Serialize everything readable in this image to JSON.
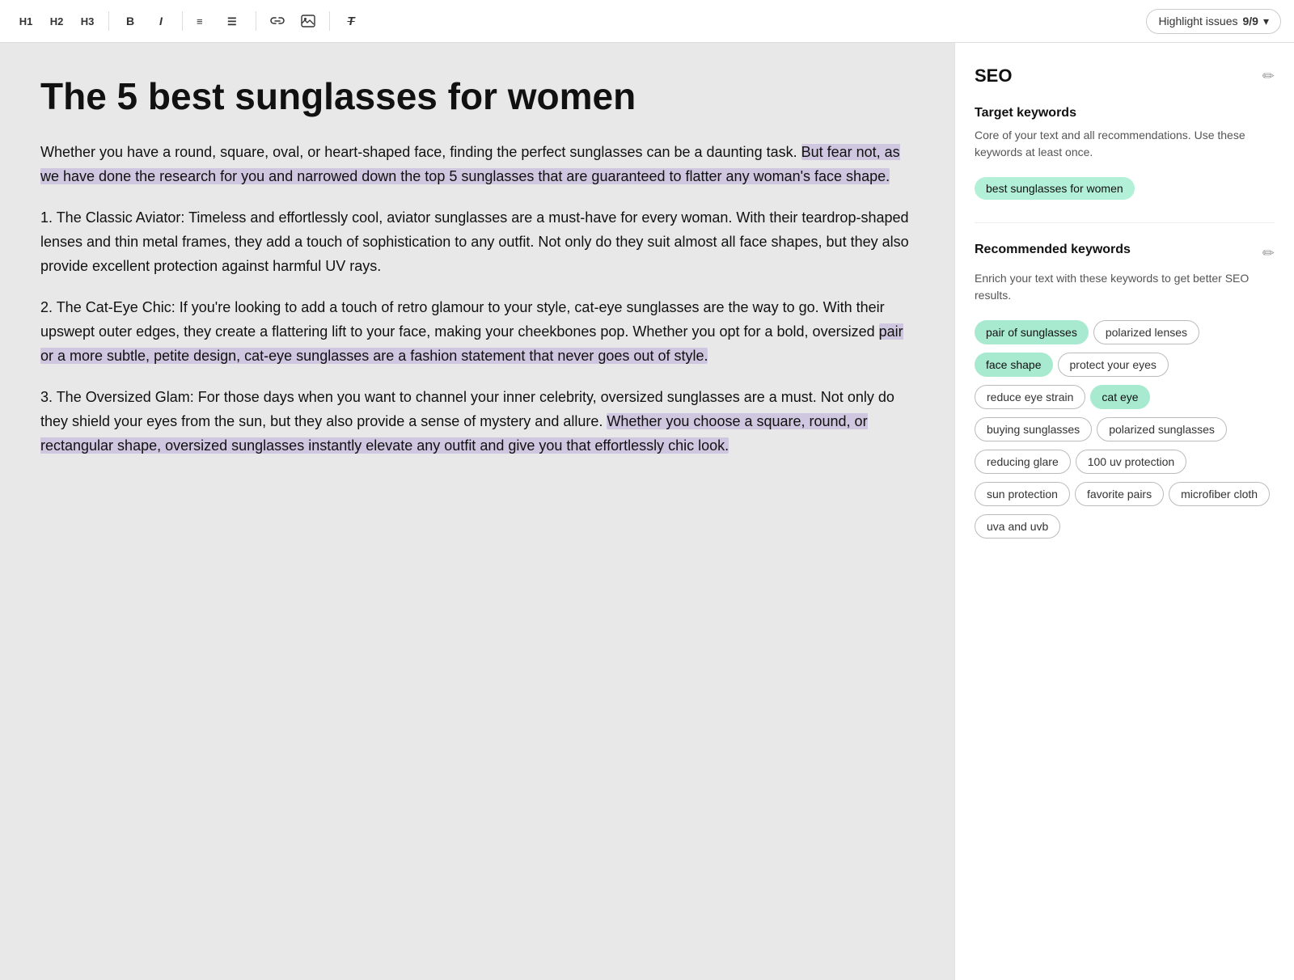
{
  "toolbar": {
    "h1_label": "H1",
    "h2_label": "H2",
    "h3_label": "H3",
    "bold_label": "B",
    "italic_label": "I",
    "highlight_issues_label": "Highlight issues",
    "highlight_count": "9/9",
    "chevron": "▾"
  },
  "editor": {
    "title": "The 5 best sunglasses for women",
    "paragraphs": [
      {
        "id": "p1",
        "text_plain": "Whether you have a round, square, oval, or heart-shaped face, finding the perfect sunglasses can be a daunting task.",
        "text_highlighted": "But fear not, as we have done the research for you and narrowed down the top 5 sunglasses that are guaranteed to flatter any woman's face shape.",
        "highlight": true
      },
      {
        "id": "p2",
        "text_plain": "1. The Classic Aviator: Timeless and effortlessly cool, aviator sunglasses are a must-have for every woman. With their teardrop-shaped lenses and thin metal frames, they add a touch of sophistication to any outfit. Not only do they suit almost all face shapes, but they also provide excellent protection against harmful UV rays.",
        "highlight": false
      },
      {
        "id": "p3",
        "text_before": "2. The Cat-Eye Chic: If you're looking to add a touch of retro glamour to your style, cat-eye sunglasses are the way to go. With their upswept outer edges, they create a flattering lift to your face, making your cheekbones pop. Whether you opt for a bold, oversized",
        "text_highlighted": "pair or a more subtle, petite design, cat-eye sunglasses are a fashion statement that never goes out of style.",
        "highlight": true
      },
      {
        "id": "p4",
        "text_before": "3. The Oversized Glam: For those days when you want to channel your inner celebrity, oversized sunglasses are a must. Not only do they shield your eyes from the sun, but they also provide a sense of mystery and allure.",
        "text_highlighted": "Whether you choose a square, round, or rectangular shape, oversized sunglasses instantly elevate any outfit and give you that effortlessly chic look.",
        "highlight": true
      }
    ]
  },
  "seo": {
    "title": "SEO",
    "target_keywords_title": "Target keywords",
    "target_keywords_desc": "Core of your text and all recommendations. Use these keywords at least once.",
    "target_keywords": [
      {
        "label": "best sunglasses for women",
        "style": "green"
      }
    ],
    "recommended_keywords_title": "Recommended keywords",
    "recommended_keywords_desc": "Enrich your text with these keywords to get better SEO results.",
    "recommended_keywords": [
      {
        "label": "pair of sunglasses",
        "style": "teal"
      },
      {
        "label": "polarized lenses",
        "style": "outline"
      },
      {
        "label": "face shape",
        "style": "teal"
      },
      {
        "label": "protect your eyes",
        "style": "outline"
      },
      {
        "label": "reduce eye strain",
        "style": "outline"
      },
      {
        "label": "cat eye",
        "style": "teal"
      },
      {
        "label": "buying sunglasses",
        "style": "outline"
      },
      {
        "label": "polarized sunglasses",
        "style": "outline"
      },
      {
        "label": "reducing glare",
        "style": "outline"
      },
      {
        "label": "100 uv protection",
        "style": "outline"
      },
      {
        "label": "sun protection",
        "style": "outline"
      },
      {
        "label": "favorite pairs",
        "style": "outline"
      },
      {
        "label": "microfiber cloth",
        "style": "outline"
      },
      {
        "label": "uva and uvb",
        "style": "outline"
      }
    ]
  }
}
